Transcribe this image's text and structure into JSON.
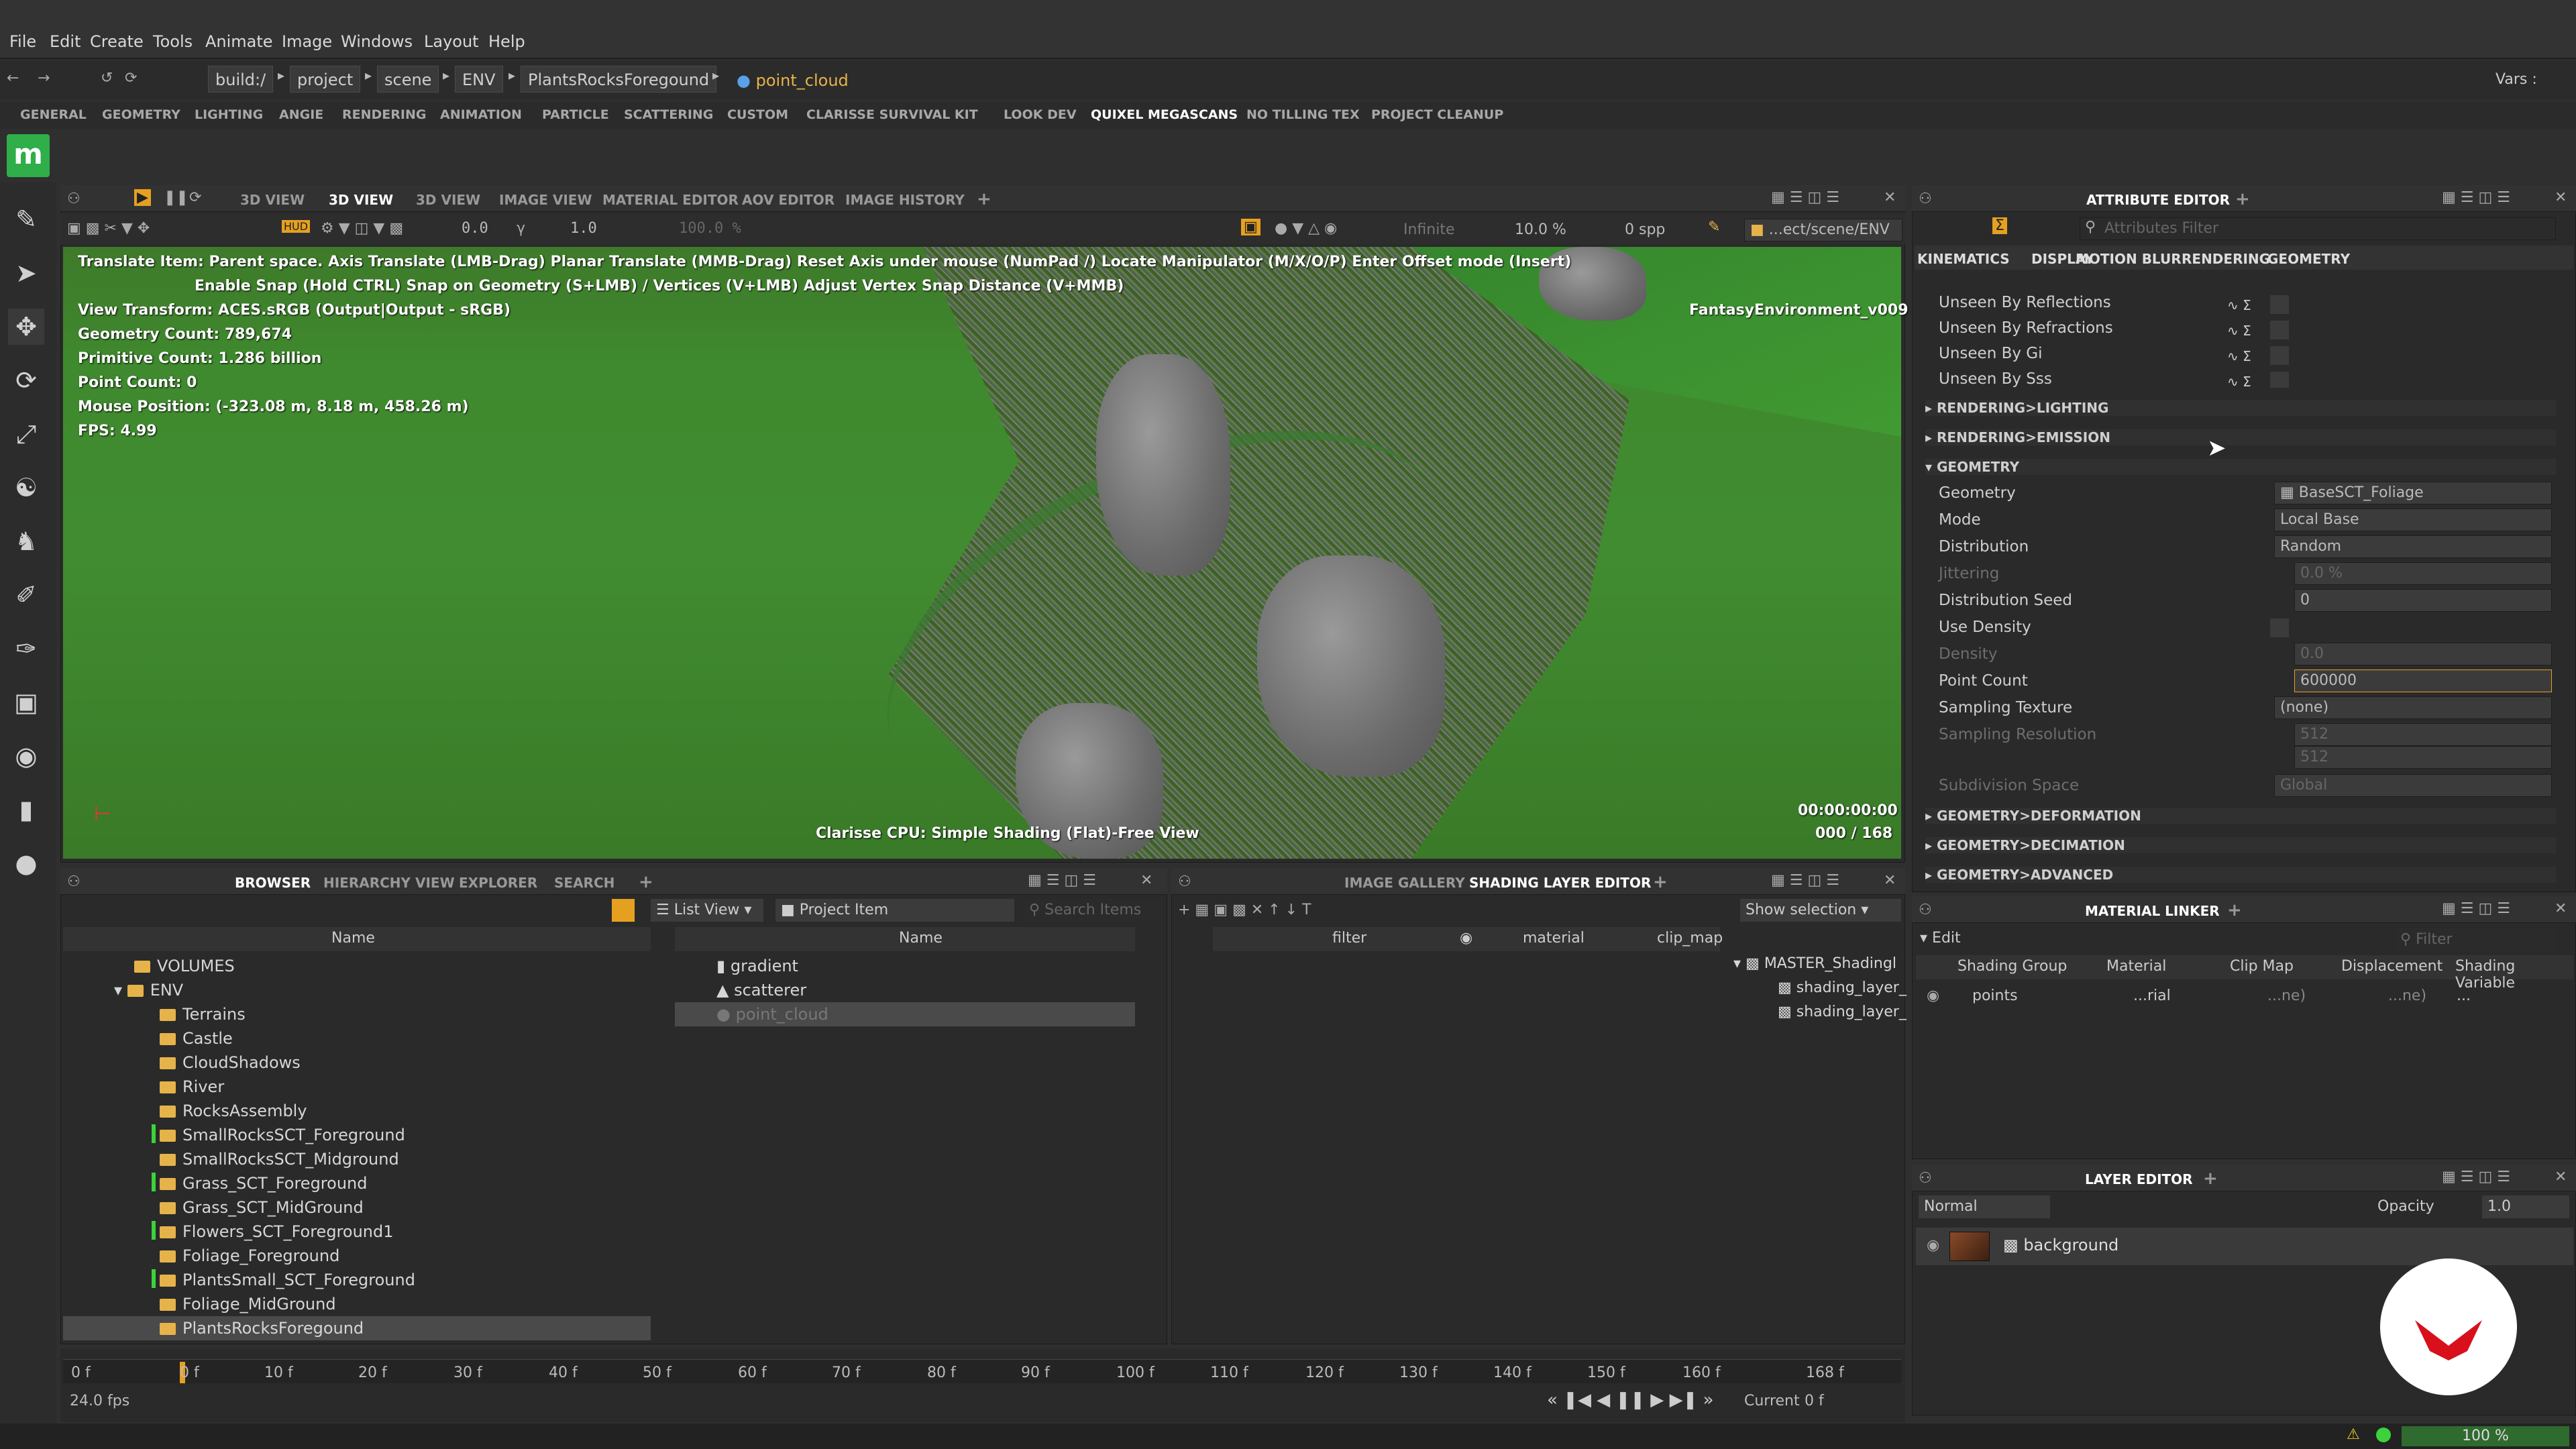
{
  "menu": [
    "File",
    "Edit",
    "Create",
    "Tools",
    "Animate",
    "Image",
    "Windows",
    "Layout",
    "Help"
  ],
  "path": {
    "crumbs": [
      "build:/",
      "project",
      "scene",
      "ENV",
      "PlantsRocksForegound"
    ],
    "current": "point_cloud",
    "vars": "Vars :"
  },
  "shelves": [
    "GENERAL",
    "GEOMETRY",
    "LIGHTING",
    "ANGIE",
    "RENDERING",
    "ANIMATION",
    "PARTICLE",
    "SCATTERING",
    "CUSTOM",
    "CLARISSE SURVIVAL KIT",
    "LOOK DEV",
    "QUIXEL MEGASCANS",
    "NO TILLING TEX",
    "PROJECT CLEANUP"
  ],
  "logo": "m",
  "viewport_tabs": [
    "3D VIEW",
    "3D VIEW",
    "3D VIEW",
    "IMAGE VIEW",
    "MATERIAL EDITOR",
    "AOV EDITOR",
    "IMAGE HISTORY"
  ],
  "viewport_toolbar": {
    "v1": "0.0",
    "v2": "1.0",
    "v3": "100.0 %",
    "infinite": "Infinite",
    "pct": "10.0 %",
    "spp": "0 spp",
    "path": "...ect/scene/ENV"
  },
  "viewport": {
    "info_line1": "Translate Item: Parent space. Axis Translate (LMB-Drag)  Planar Translate (MMB-Drag) Reset Axis under mouse (NumPad /)  Locate Manipulator (M/X/O/P)  Enter Offset mode (Insert)",
    "info_line2": "Enable Snap (Hold CTRL) Snap on Geometry (S+LMB) / Vertices (V+LMB) Adjust Vertex Snap Distance (V+MMB)",
    "view_transform": "View Transform: ACES.sRGB (Output|Output - sRGB)",
    "geometry_count": "Geometry Count: 789,674",
    "primitive_count": "Primitive Count: 1.286 billion",
    "point_count": "Point Count: 0",
    "mouse_position": "Mouse Position:  (-323.08 m, 8.18 m, 458.26 m)",
    "fps": "FPS: 4.99",
    "camera": "FantasyEnvironment_v009",
    "timecode": "00:00:00:00",
    "frames": "000 / 168",
    "renderer": "Clarisse CPU: Simple Shading (Flat)-Free View"
  },
  "attribute_editor": {
    "title": "ATTRIBUTE EDITOR",
    "filter_placeholder": "Attributes Filter",
    "tabs": [
      "KINEMATICS",
      "DISPLAY",
      "MOTION BLUR",
      "RENDERING",
      "GEOMETRY"
    ],
    "unseen": [
      "Unseen By Reflections",
      "Unseen By Refractions",
      "Unseen By Gi",
      "Unseen By Sss"
    ],
    "sections": [
      "RENDERING>LIGHTING",
      "RENDERING>EMISSION",
      "GEOMETRY",
      "GEOMETRY>DEFORMATION",
      "GEOMETRY>DECIMATION",
      "GEOMETRY>ADVANCED"
    ],
    "fields": [
      {
        "label": "Geometry",
        "value": "BaseSCT_Foliage",
        "dim": false
      },
      {
        "label": "Mode",
        "value": "Local Base",
        "dim": false
      },
      {
        "label": "Distribution",
        "value": "Random",
        "dim": false
      },
      {
        "label": "Jittering",
        "value": "0.0 %",
        "dim": true
      },
      {
        "label": "Distribution Seed",
        "value": "0",
        "dim": false
      },
      {
        "label": "Use Density",
        "value": "",
        "dim": false
      },
      {
        "label": "Density",
        "value": "0.0",
        "dim": true
      },
      {
        "label": "Point Count",
        "value": "600000",
        "dim": false
      },
      {
        "label": "Sampling Texture",
        "value": "(none)",
        "dim": false
      },
      {
        "label": "Sampling Resolution",
        "value": "512",
        "dim": true
      },
      {
        "label": "",
        "value": "512",
        "dim": true
      },
      {
        "label": "Subdivision Space",
        "value": "Global",
        "dim": true
      }
    ]
  },
  "browser": {
    "tabs": [
      "BROWSER",
      "HIERARCHY VIEW",
      "EXPLORER",
      "SEARCH"
    ],
    "list_view": "List View",
    "project_item": "Project Item",
    "search_placeholder": "Search Items",
    "col_name": "Name",
    "tree": [
      "VOLUMES",
      "ENV",
      "Terrains",
      "Castle",
      "CloudShadows",
      "River",
      "RocksAssembly",
      "SmallRocksSCT_Foreground",
      "SmallRocksSCT_Midground",
      "Grass_SCT_Foreground",
      "Grass_SCT_MidGround",
      "Flowers_SCT_Foreground1",
      "Foliage_Foreground",
      "PlantsSmall_SCT_Foreground",
      "Foliage_MidGround",
      "PlantsRocksForegound"
    ],
    "items": [
      "gradient",
      "scatterer",
      "point_cloud"
    ]
  },
  "shading": {
    "tabs": [
      "IMAGE GALLERY",
      "SHADING LAYER EDITOR"
    ],
    "show_selection": "Show selection",
    "cols": [
      "filter",
      "material",
      "clip_map"
    ],
    "tree": [
      "MASTER_Shadingl",
      "shading_layer_",
      "shading_layer_"
    ]
  },
  "material_linker": {
    "title": "MATERIAL LINKER",
    "edit": "Edit",
    "filter": "Filter",
    "cols": [
      "Shading Group",
      "Material",
      "Clip Map",
      "Displacement",
      "Shading Variable"
    ],
    "row": {
      "group": "points",
      "material": "...rial",
      "clip": "...ne)",
      "disp": "...ne)",
      "var": "..."
    }
  },
  "layer_editor": {
    "title": "LAYER EDITOR",
    "blend": "Normal",
    "opacity_label": "Opacity",
    "opacity": "1.0",
    "layer": "background"
  },
  "timeline": {
    "start": "0 f",
    "end": "168 f",
    "fps": "24.0 fps",
    "current_label": "Current",
    "current": "0 f",
    "ticks": [
      "0 f",
      "10 f",
      "20 f",
      "30 f",
      "40 f",
      "50 f",
      "60 f",
      "70 f",
      "80 f",
      "90 f",
      "100 f",
      "110 f",
      "120 f",
      "130 f",
      "140 f",
      "150 f",
      "160 f"
    ]
  },
  "status": {
    "zoom": "100 %"
  },
  "colors": {
    "accent": "#e6b34a",
    "viewport_green": "#3f8a2e",
    "logo": "#2fae4a",
    "brand_red": "#d8101b"
  }
}
